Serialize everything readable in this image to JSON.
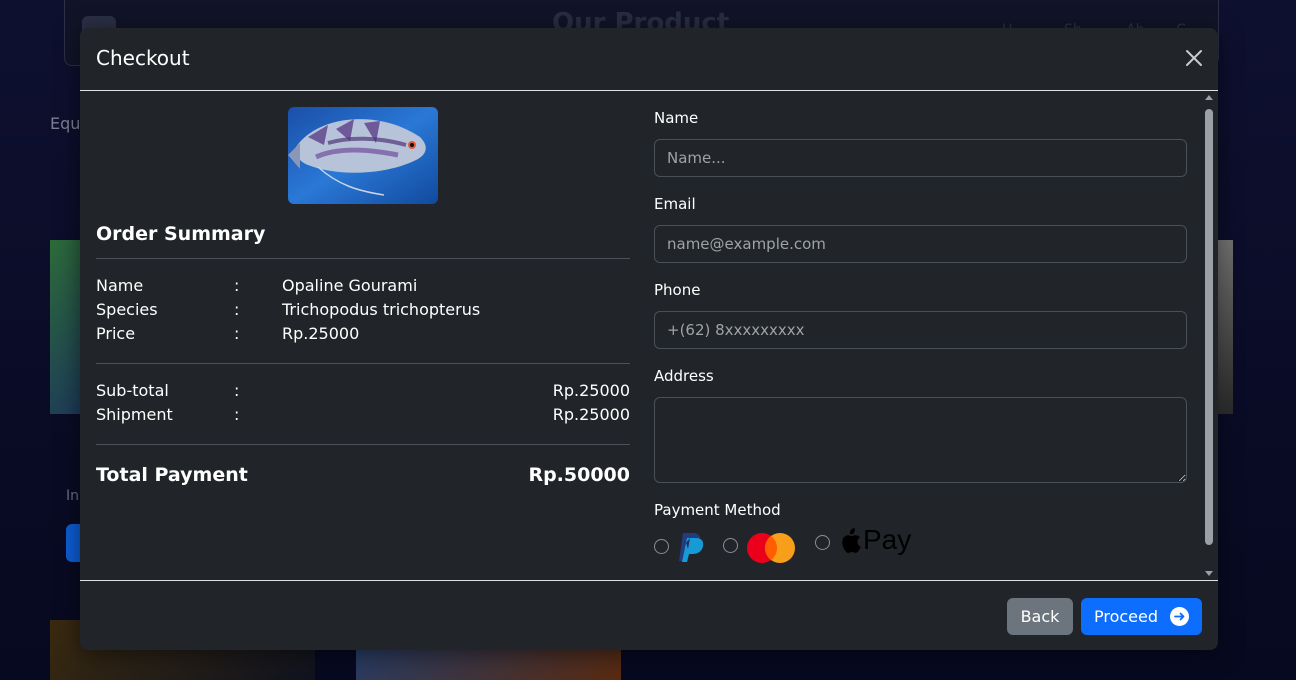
{
  "background": {
    "page_title": "Our Product",
    "category_label": "Equ",
    "card_caption": "In",
    "nav": [
      "H",
      "Sh",
      "Ab",
      "C"
    ]
  },
  "modal": {
    "title": "Checkout",
    "product_image_alt": "Opaline Gourami fish",
    "summary": {
      "heading": "Order Summary",
      "colon": ":",
      "rows": [
        {
          "label": "Name",
          "value": "Opaline Gourami"
        },
        {
          "label": "Species",
          "value": "Trichopodus trichopterus"
        },
        {
          "label": "Price",
          "value": "Rp.25000"
        }
      ],
      "costs": [
        {
          "label": "Sub-total",
          "value": "Rp.25000"
        },
        {
          "label": "Shipment",
          "value": "Rp.25000"
        }
      ],
      "total_label": "Total Payment",
      "total_value": "Rp.50000"
    },
    "form": {
      "name_label": "Name",
      "name_placeholder": "Name...",
      "email_label": "Email",
      "email_placeholder": "name@example.com",
      "phone_label": "Phone",
      "phone_value": "+(62) 8xxxxxxxxx",
      "address_label": "Address",
      "address_value": "",
      "payment_label": "Payment Method",
      "payment_options": [
        {
          "name": "PayPal",
          "icon": "paypal-icon",
          "selected": false
        },
        {
          "name": "Mastercard",
          "icon": "mastercard-icon",
          "selected": false
        },
        {
          "name": "Apple Pay",
          "icon": "apple-pay-icon",
          "selected": false,
          "text": "Pay"
        }
      ]
    },
    "footer": {
      "back_label": "Back",
      "proceed_label": "Proceed"
    }
  },
  "colors": {
    "modal_bg": "#212529",
    "primary": "#0d6efd",
    "secondary": "#6c757d",
    "border": "#495057",
    "page_bg": "#080a22"
  }
}
